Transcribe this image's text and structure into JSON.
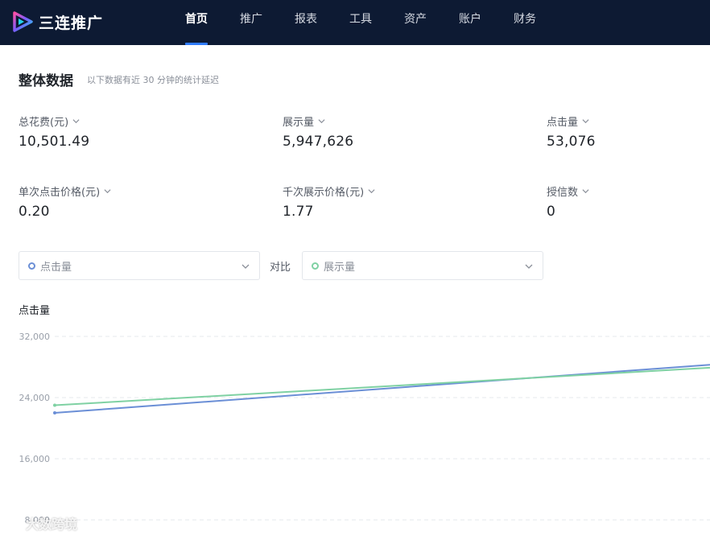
{
  "app": {
    "logo_text": "三连推广"
  },
  "nav": {
    "items": [
      {
        "label": "首页",
        "active": true
      },
      {
        "label": "推广",
        "active": false
      },
      {
        "label": "报表",
        "active": false
      },
      {
        "label": "工具",
        "active": false
      },
      {
        "label": "资产",
        "active": false
      },
      {
        "label": "账户",
        "active": false
      },
      {
        "label": "财务",
        "active": false
      }
    ]
  },
  "overview": {
    "title": "整体数据",
    "note": "以下数据有近 30 分钟的统计延迟",
    "metrics": [
      {
        "label": "总花费(元)",
        "value": "10,501.49"
      },
      {
        "label": "展示量",
        "value": "5,947,626"
      },
      {
        "label": "点击量",
        "value": "53,076"
      },
      {
        "label": "单次点击价格(元)",
        "value": "0.20"
      },
      {
        "label": "千次展示价格(元)",
        "value": "1.77"
      },
      {
        "label": "授信数",
        "value": "0"
      }
    ]
  },
  "compare": {
    "primary": {
      "label": "点击量",
      "dot_color": "#6b8fd6"
    },
    "connector": "对比",
    "secondary": {
      "label": "展示量",
      "dot_color": "#7fd1a3"
    }
  },
  "chart_data": {
    "type": "line",
    "title": "点击量",
    "ylabel": "点击量",
    "yticks": [
      "32,000",
      "24,000",
      "16,000",
      "8,000"
    ],
    "ylim": [
      8000,
      32000
    ],
    "grid": true,
    "x": [
      0,
      1
    ],
    "series": [
      {
        "color": "#6b8fd6",
        "values": [
          22000,
          28300
        ]
      },
      {
        "color": "#7fd1a3",
        "values": [
          23000,
          27900
        ]
      }
    ]
  },
  "watermark": {
    "text": "大数跨境"
  }
}
